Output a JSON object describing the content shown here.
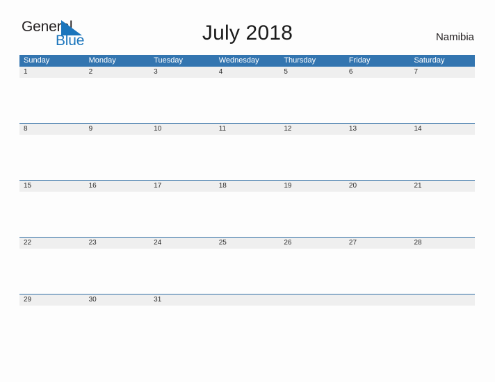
{
  "logo": {
    "primary_text": "General",
    "secondary_text": "Blue",
    "mark": "triangle-mark",
    "primary_color": "#231f20",
    "secondary_color": "#1b75bc"
  },
  "header": {
    "title": "July 2018",
    "country": "Namibia"
  },
  "calendar": {
    "accent_color": "#3375b0",
    "separator_color": "#2e6da4",
    "date_band_color": "#efefef",
    "weekday_headers": [
      "Sunday",
      "Monday",
      "Tuesday",
      "Wednesday",
      "Thursday",
      "Friday",
      "Saturday"
    ],
    "weeks": [
      {
        "dates": [
          "1",
          "2",
          "3",
          "4",
          "5",
          "6",
          "7"
        ]
      },
      {
        "dates": [
          "8",
          "9",
          "10",
          "11",
          "12",
          "13",
          "14"
        ]
      },
      {
        "dates": [
          "15",
          "16",
          "17",
          "18",
          "19",
          "20",
          "21"
        ]
      },
      {
        "dates": [
          "22",
          "23",
          "24",
          "25",
          "26",
          "27",
          "28"
        ]
      },
      {
        "dates": [
          "29",
          "30",
          "31",
          "",
          "",
          "",
          ""
        ]
      }
    ]
  }
}
